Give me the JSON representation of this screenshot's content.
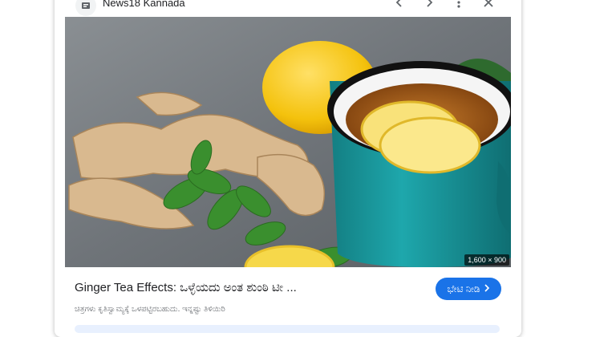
{
  "source": {
    "name": "News18 Kannada",
    "favicon_icon": "news18-logo-icon"
  },
  "toolbar": {
    "prev_icon": "chevron-left-icon",
    "next_icon": "chevron-right-icon",
    "more_icon": "more-vert-icon",
    "close_icon": "close-icon"
  },
  "image": {
    "dimensions_label": "1,600 × 900",
    "subject": "ginger-tea-with-lemon-and-mint"
  },
  "result": {
    "title": "Ginger Tea Effects: ಒಳ್ಳೆಯದು ಅಂತ ಶುಂಠಿ ಟೀ ...",
    "visit_label": "ಭೇಟಿ ನೀಡಿ",
    "caption": "ಚಿತ್ರಗಳು ಕೃತಿಸ್ವಾಮ್ಯಕ್ಕೆ ಒಳಪಟ್ಟಿರಬಹುದು. ಇನ್ನಷ್ಟು ತಿಳಿಯಿರಿ"
  },
  "colors": {
    "accent": "#1a73e8",
    "mug": "#1e9ea3"
  }
}
